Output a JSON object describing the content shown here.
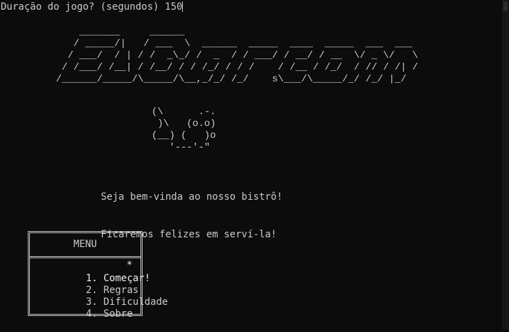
{
  "console": {
    "prompt": "Duração do jogo? (segundos) ",
    "input_value": "150"
  },
  "logo": {
    "ascii": "     _______     ______\n    / _____/|   / ___  \\  ______  _____  ____  _____  ___  ___\n   / ___/  / | / /  _\\_/ /  _  / / ___/ / __/ / __  \\/ _ \\/   \\\n  / /___/ /__| / /__/ / / /_/ / / /    / /__ / /_/  / // / /| /\n /______/_____/\\_____/\\__,_/_/ /_/    s\\___/\\_____/_/ /_/ |_/"
  },
  "mascot": {
    "ascii": "(\\      .-.\n )\\   (o.o)\n(__) (   )o\n   '---'-\""
  },
  "welcome": {
    "line1": "Seja bem-vinda ao nosso bistrô!",
    "line2": "Ficaremos felizes em serví-la!"
  },
  "menu": {
    "title": "MENU",
    "items": [
      {
        "label": "1. Começar!"
      },
      {
        "label": "2. Regras"
      },
      {
        "label": "3. Dificuldade"
      },
      {
        "label": "4. Sobre"
      }
    ],
    "selection_marker": "*"
  },
  "colors": {
    "background": "#0c0c0c",
    "text": "#cccccc",
    "highlight": "#f2f2f2"
  }
}
